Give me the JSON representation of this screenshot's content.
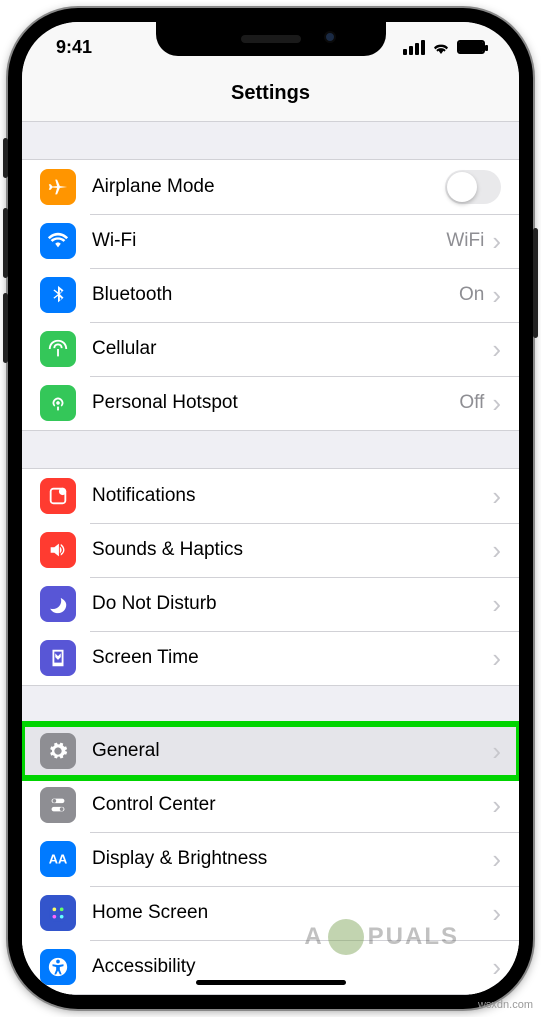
{
  "status": {
    "time": "9:41"
  },
  "header": {
    "title": "Settings"
  },
  "groups": [
    [
      {
        "id": "airplane",
        "label": "Airplane Mode",
        "color": "#ff9500",
        "control": "toggle"
      },
      {
        "id": "wifi",
        "label": "Wi-Fi",
        "color": "#007aff",
        "value": "WiFi",
        "control": "nav"
      },
      {
        "id": "bluetooth",
        "label": "Bluetooth",
        "color": "#007aff",
        "value": "On",
        "control": "nav"
      },
      {
        "id": "cellular",
        "label": "Cellular",
        "color": "#34c759",
        "control": "nav"
      },
      {
        "id": "hotspot",
        "label": "Personal Hotspot",
        "color": "#34c759",
        "value": "Off",
        "control": "nav"
      }
    ],
    [
      {
        "id": "notifications",
        "label": "Notifications",
        "color": "#ff3b30",
        "control": "nav"
      },
      {
        "id": "sounds",
        "label": "Sounds & Haptics",
        "color": "#ff3b30",
        "control": "nav"
      },
      {
        "id": "dnd",
        "label": "Do Not Disturb",
        "color": "#5856d6",
        "control": "nav"
      },
      {
        "id": "screentime",
        "label": "Screen Time",
        "color": "#5856d6",
        "control": "nav"
      }
    ],
    [
      {
        "id": "general",
        "label": "General",
        "color": "#8e8e93",
        "control": "nav",
        "highlighted": true
      },
      {
        "id": "control",
        "label": "Control Center",
        "color": "#8e8e93",
        "control": "nav"
      },
      {
        "id": "display",
        "label": "Display & Brightness",
        "color": "#007aff",
        "control": "nav"
      },
      {
        "id": "home",
        "label": "Home Screen",
        "color": "#3355cc",
        "control": "nav"
      },
      {
        "id": "accessibility",
        "label": "Accessibility",
        "color": "#007aff",
        "control": "nav"
      }
    ]
  ],
  "watermark": {
    "text_before": "A",
    "text_after": "PUALS"
  },
  "source": "wsxdn.com"
}
